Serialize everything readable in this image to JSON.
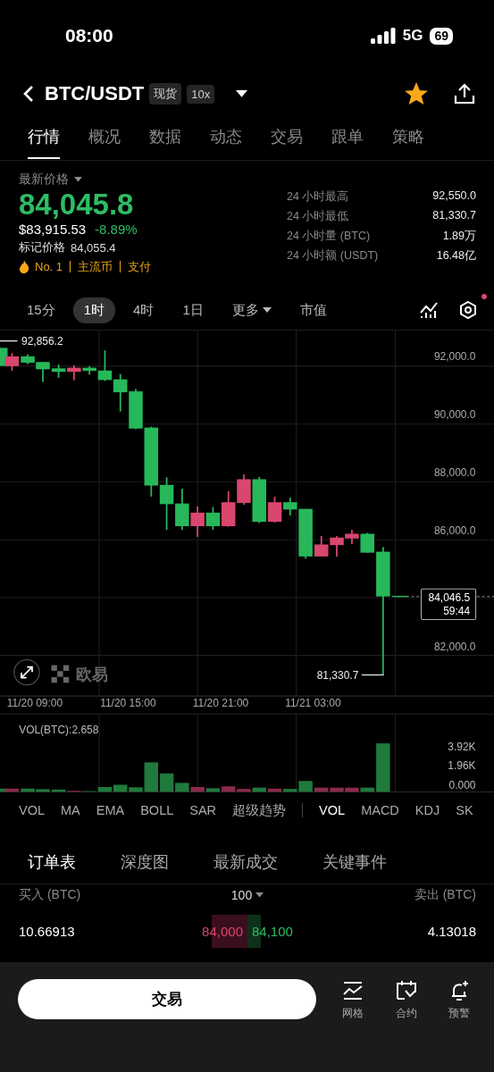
{
  "status_bar": {
    "time": "08:00",
    "network": "5G",
    "battery": "69"
  },
  "header": {
    "pair": "BTC/USDT",
    "badges": [
      "现货",
      "10x"
    ],
    "favorite": true
  },
  "tabs": [
    {
      "label": "行情",
      "selected": true
    },
    {
      "label": "概况",
      "selected": false
    },
    {
      "label": "数据",
      "selected": false
    },
    {
      "label": "动态",
      "selected": false
    },
    {
      "label": "交易",
      "selected": false
    },
    {
      "label": "跟单",
      "selected": false
    },
    {
      "label": "策略",
      "selected": false
    }
  ],
  "price": {
    "label": "最新价格",
    "last": "84,045.8",
    "usd": "$83,915.53",
    "change": "-8.89%",
    "mark_label": "标记价格",
    "mark": "84,055.4",
    "rank": "No. 1",
    "tags": [
      "主流币",
      "支付"
    ]
  },
  "stats": [
    {
      "label": "24 小时最高",
      "value": "92,550.0"
    },
    {
      "label": "24 小时最低",
      "value": "81,330.7"
    },
    {
      "label": "24 小时量 (BTC)",
      "value": "1.89万"
    },
    {
      "label": "24 小时额 (USDT)",
      "value": "16.48亿"
    }
  ],
  "intervals": [
    {
      "label": "15分",
      "selected": false
    },
    {
      "label": "1时",
      "selected": true
    },
    {
      "label": "4时",
      "selected": false
    },
    {
      "label": "1日",
      "selected": false
    }
  ],
  "more": "更多",
  "market_cap": "市值",
  "settings_alert": true,
  "chart": {
    "high_label": "92,856.2",
    "y_labels": [
      "92,000.0",
      "90,000.0",
      "88,000.0",
      "86,000.0",
      "82,000.0"
    ],
    "price_tag": "84,046.5",
    "countdown": "59:44",
    "low_label": "81,330.7",
    "logo": "欧易",
    "x_labels": [
      "11/20 09:00",
      "11/20 15:00",
      "11/20 21:00",
      "11/21 03:00"
    ]
  },
  "volume": {
    "title": "VOL(BTC):2.658",
    "y_labels": [
      "3.92K",
      "1.96K",
      "0.000"
    ]
  },
  "indicators": {
    "main": [
      {
        "label": "VOL",
        "selected": false
      },
      {
        "label": "MA",
        "selected": false
      },
      {
        "label": "EMA",
        "selected": false
      },
      {
        "label": "BOLL",
        "selected": false
      },
      {
        "label": "SAR",
        "selected": false
      },
      {
        "label": "超级趋势",
        "selected": false
      }
    ],
    "sub": [
      {
        "label": "VOL",
        "selected": true
      },
      {
        "label": "MACD",
        "selected": false
      },
      {
        "label": "KDJ",
        "selected": false
      },
      {
        "label": "SK",
        "selected": false
      }
    ]
  },
  "book_tabs": [
    {
      "label": "订单表",
      "selected": true
    },
    {
      "label": "深度图",
      "selected": false
    },
    {
      "label": "最新成交",
      "selected": false
    },
    {
      "label": "关键事件",
      "selected": false
    }
  ],
  "book": {
    "bid_header": "买入 (BTC)",
    "step": "100",
    "ask_header": "卖出 (BTC)",
    "rows": [
      {
        "bid_amount": "10.66913",
        "bid_price": "84,000",
        "ask_price": "84,100",
        "ask_amount": "4.13018"
      }
    ]
  },
  "bottom": {
    "trade": "交易",
    "actions": [
      {
        "label": "网格",
        "kind": "grid"
      },
      {
        "label": "合约",
        "kind": "contract"
      },
      {
        "label": "预警",
        "kind": "alert"
      }
    ]
  }
}
